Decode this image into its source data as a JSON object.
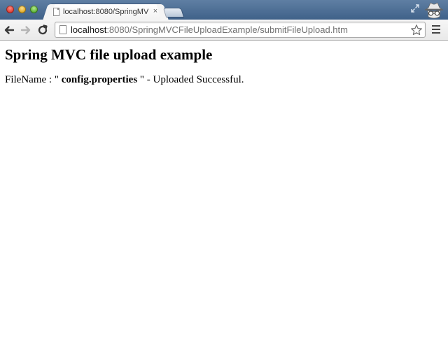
{
  "browser": {
    "tab": {
      "title": "localhost:8080/SpringMVC",
      "close_glyph": "×"
    },
    "address_bar": {
      "host": "localhost",
      "rest": ":8080/SpringMVCFileUploadExample/submitFileUpload.htm"
    },
    "icons": {
      "back": "back-arrow-icon",
      "forward": "forward-arrow-icon",
      "reload": "reload-icon",
      "bookmark": "star-icon",
      "menu": "hamburger-menu-icon",
      "incognito": "incognito-icon",
      "fullscreen": "fullscreen-icon"
    }
  },
  "page": {
    "heading": "Spring MVC file upload example",
    "result": {
      "prefix": "FileName : \" ",
      "filename": "config.properties",
      "suffix": " \" - Uploaded Successful."
    }
  },
  "colors": {
    "titlebar": "#4d6f97",
    "toolbar": "#eeeeee"
  }
}
